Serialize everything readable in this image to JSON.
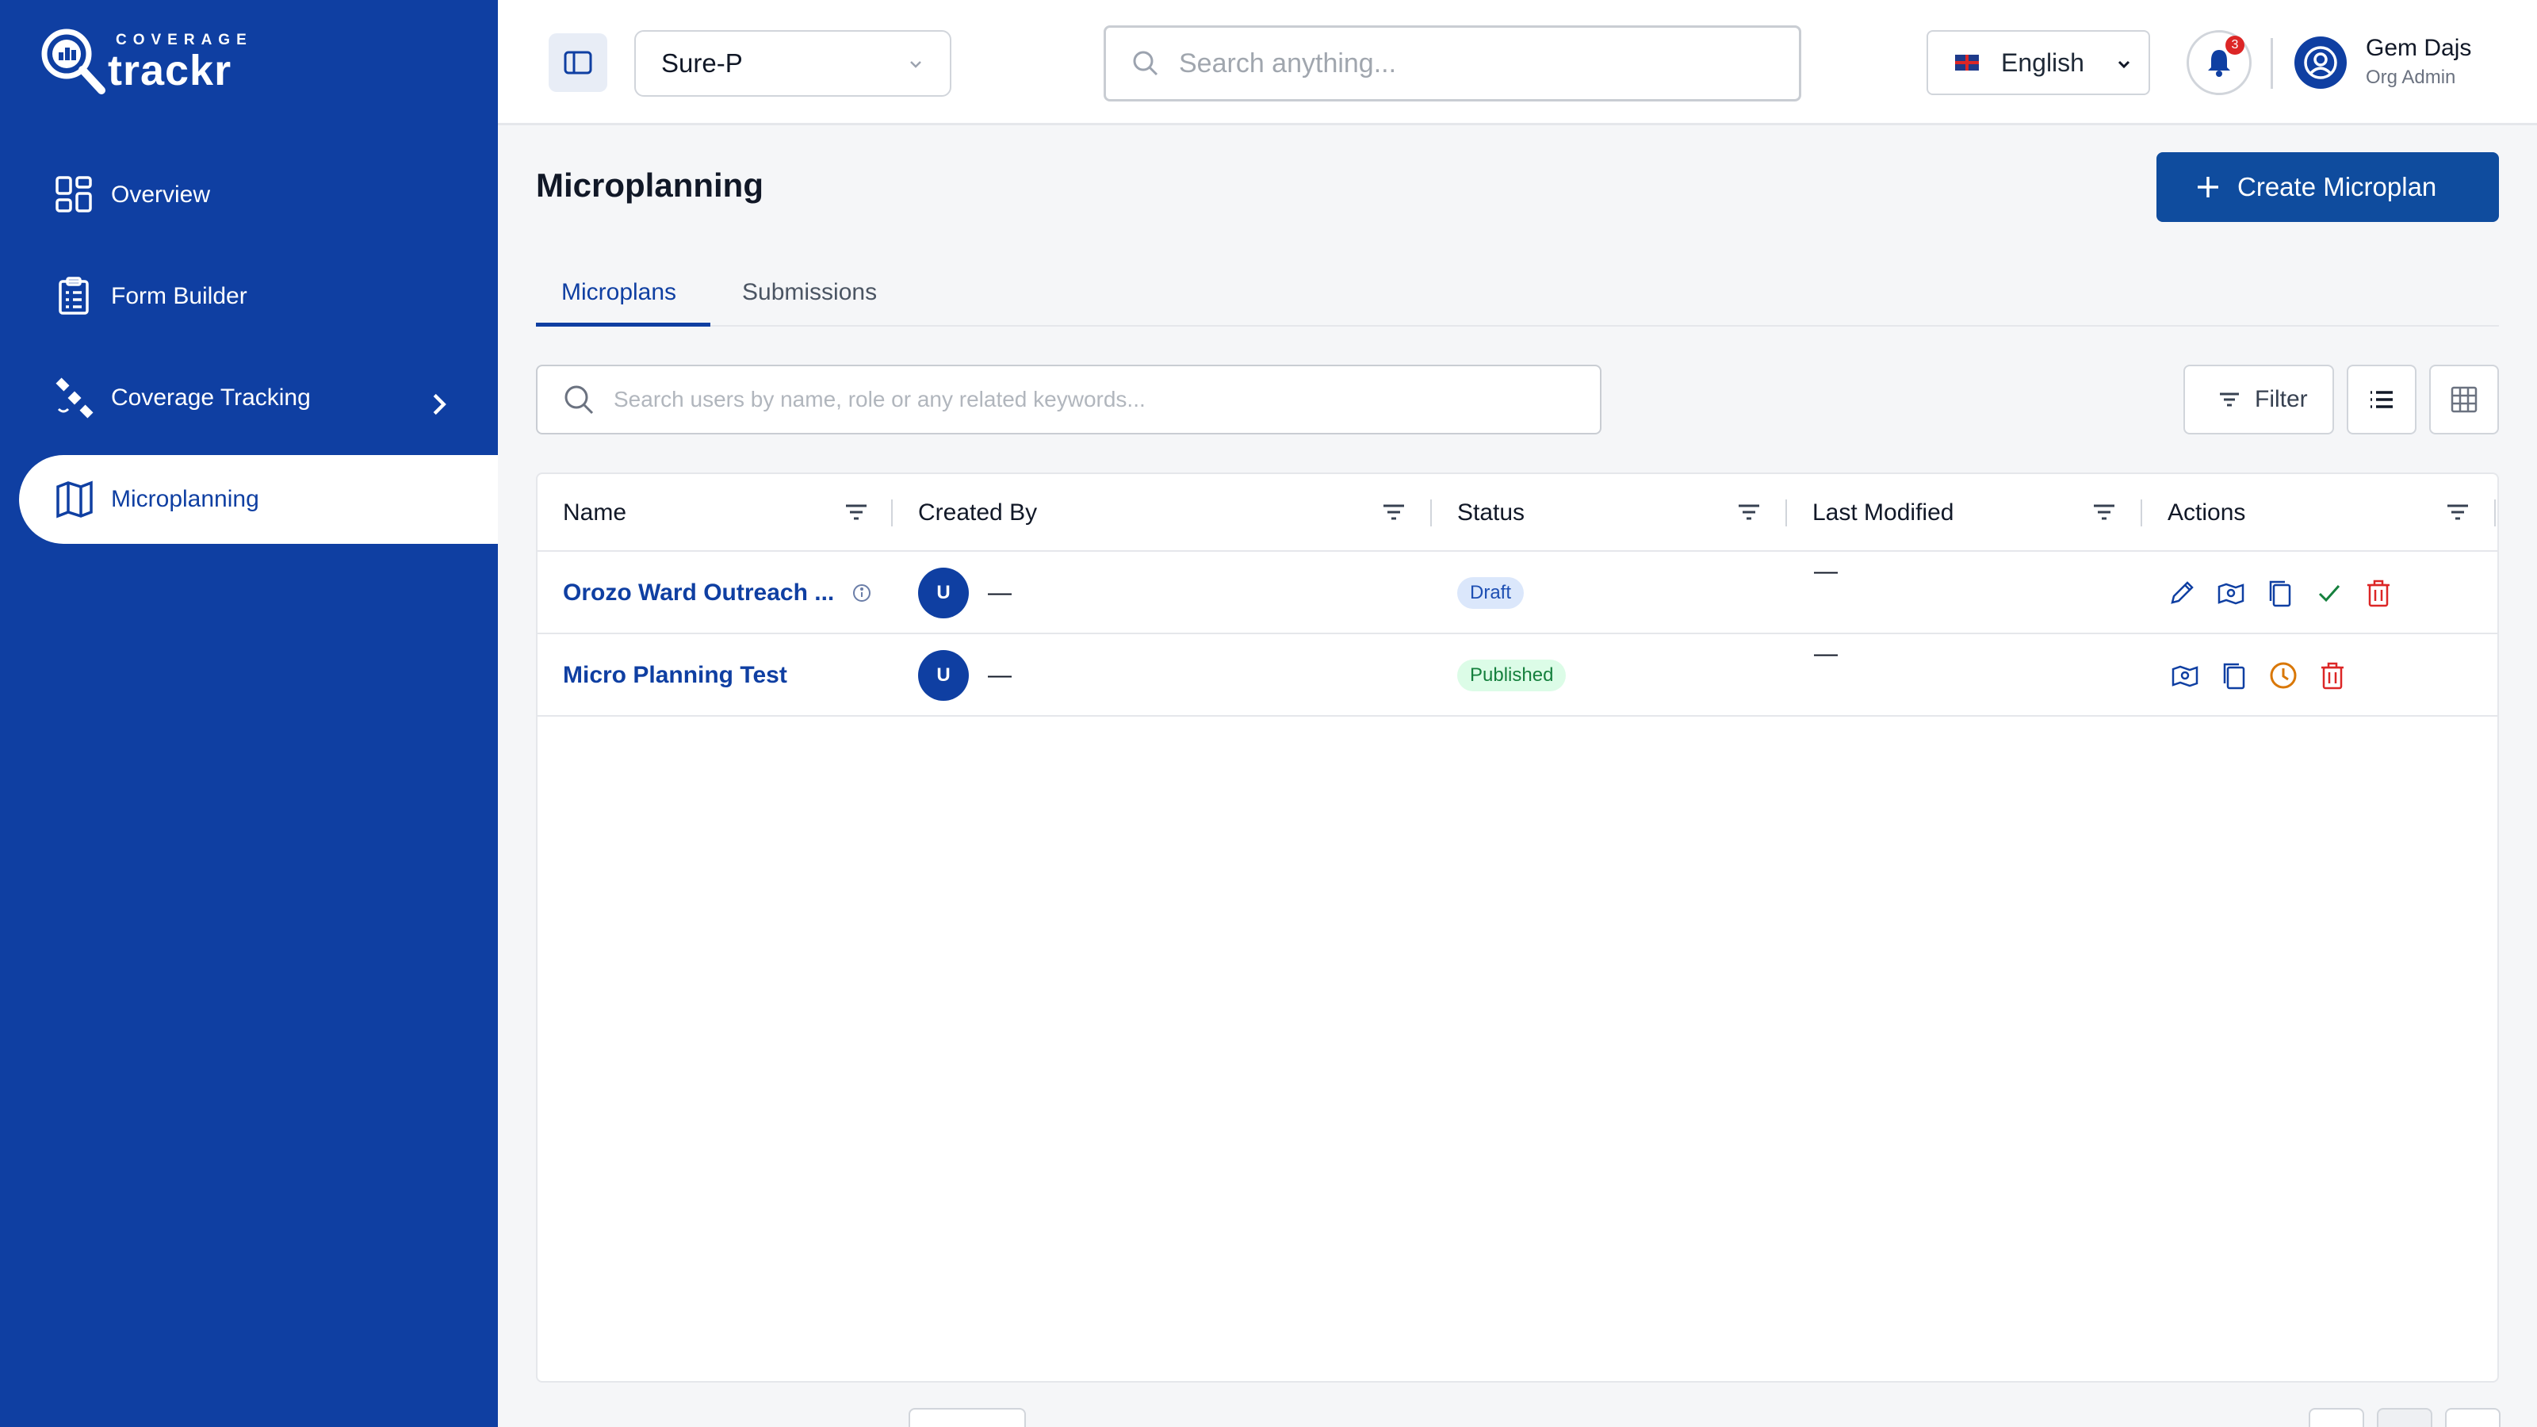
{
  "brand": {
    "top": "COVERAGE",
    "name": "trackr"
  },
  "sidebar": {
    "items": [
      {
        "label": "Overview",
        "icon": "overview-icon"
      },
      {
        "label": "Form Builder",
        "icon": "form-builder-icon"
      },
      {
        "label": "Coverage Tracking",
        "icon": "satellite-icon"
      },
      {
        "label": "Microplanning",
        "icon": "map-icon",
        "active": true
      }
    ]
  },
  "header": {
    "project": "Sure-P",
    "search_placeholder": "Search anything...",
    "language": "English",
    "notifications": "3",
    "user_name": "Gem Dajs",
    "user_role": "Org Admin"
  },
  "main": {
    "title": "Microplanning",
    "create_label": "Create Microplan",
    "tabs": [
      {
        "label": "Microplans",
        "active": true
      },
      {
        "label": "Submissions"
      }
    ],
    "search_placeholder": "Search users by name, role or any related keywords...",
    "filter_label": "Filter"
  },
  "table": {
    "headers": [
      "Name",
      "Created By",
      "Status",
      "Last Modified",
      "Actions"
    ],
    "rows": [
      {
        "name": "Orozo Ward Outreach ...",
        "avatar": "U",
        "creator": "—",
        "status": "Draft",
        "modified": "—"
      },
      {
        "name": "Micro Planning Test",
        "avatar": "U",
        "creator": "—",
        "status": "Published",
        "modified": "—"
      }
    ]
  },
  "colors": {
    "brand": "#0f3fa2",
    "button": "#0f4c9e",
    "draft": "#1e4fb3",
    "published": "#15803d",
    "danger": "#dc2626",
    "pending": "#d97706"
  }
}
